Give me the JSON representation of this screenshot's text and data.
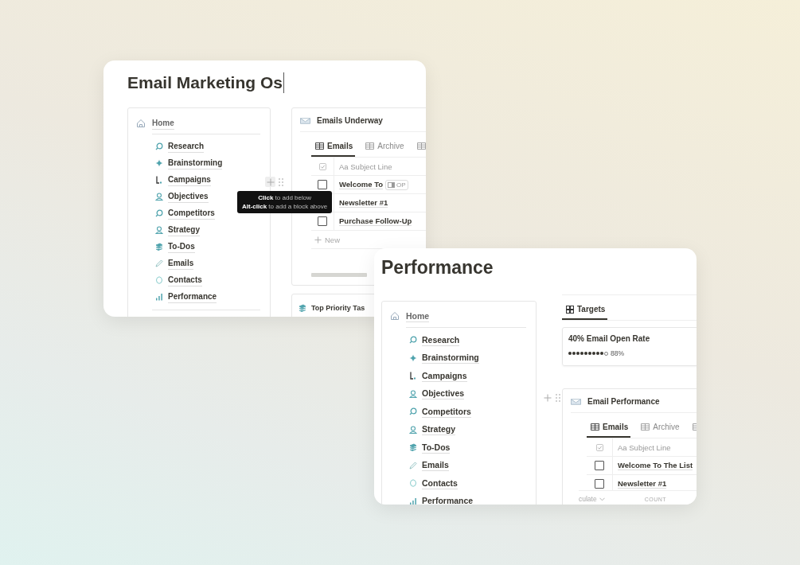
{
  "windows": [
    {
      "title": "Email Marketing Os",
      "caret": true,
      "nav": {
        "home": "Home",
        "items": [
          "Research",
          "Brainstorming",
          "Campaigns",
          "Objectives",
          "Competitors",
          "Strategy",
          "To-Dos",
          "Emails",
          "Contacts",
          "Performance"
        ]
      },
      "blocks": [
        {
          "kind": "database",
          "title": "Emails Underway",
          "tabs": [
            {
              "label": "Emails",
              "selected": true
            },
            {
              "label": "Archive",
              "selected": false
            },
            {
              "selected": false
            }
          ],
          "header": "Aa Subject Line",
          "rows": [
            {
              "title": "Welcome To",
              "checked": false,
              "open_button": "OP"
            },
            {
              "title": "Newsletter #1"
            },
            {
              "title": "Purchase Follow-Up",
              "checked": false
            }
          ],
          "new_row": "New",
          "handle": true
        },
        {
          "kind": "heading",
          "title": "Top Priority Tas"
        }
      ],
      "tooltip": [
        "**Click** to add below",
        "**Alt-click** to add a block above"
      ]
    },
    {
      "title": "Performance",
      "caret": false,
      "nav": {
        "home": "Home",
        "items": [
          "Research",
          "Brainstorming",
          "Campaigns",
          "Objectives",
          "Competitors",
          "Strategy",
          "To-Dos",
          "Emails",
          "Contacts",
          "Performance"
        ]
      },
      "blocks": [
        {
          "kind": "targets",
          "tabs": [
            {
              "label": "Targets",
              "selected": true
            }
          ],
          "card": {
            "title": "40% Email Open Rate",
            "level": 0.88,
            "reading": "88%"
          }
        },
        {
          "kind": "database",
          "title": "Email Performance",
          "tabs": [
            {
              "label": "Emails",
              "selected": true
            },
            {
              "label": "Archive",
              "selected": false
            },
            {
              "selected": false
            }
          ],
          "header": "Aa Subject Line",
          "rows": [
            {
              "title": "Welcome To The List",
              "checked": false
            },
            {
              "title": "Newsletter #1",
              "checked": false
            }
          ],
          "handle": true,
          "footer": {
            "calculate": "culate",
            "count": "COUNT"
          }
        }
      ]
    }
  ]
}
